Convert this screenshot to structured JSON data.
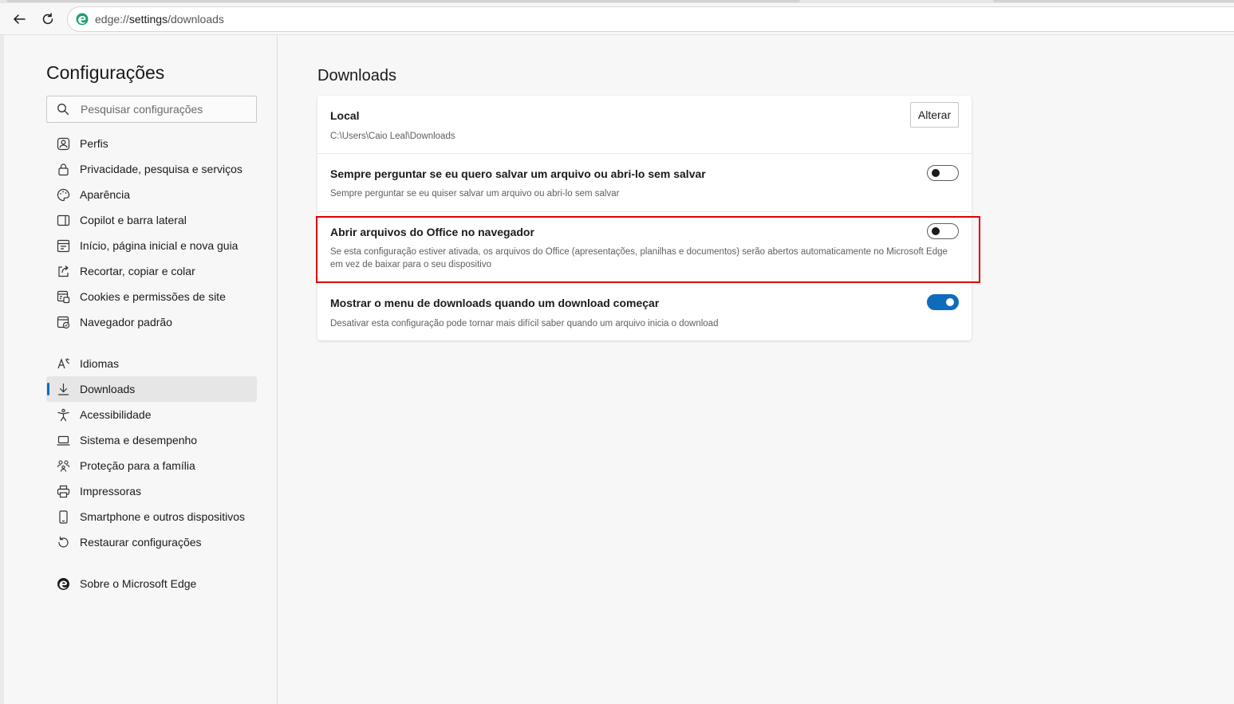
{
  "browser": {
    "url_scheme": "edge://",
    "url_host": "settings",
    "url_path": "/downloads"
  },
  "sidebar": {
    "title": "Configurações",
    "search_placeholder": "Pesquisar configurações",
    "groups": [
      [
        {
          "label": "Perfis",
          "icon": "profile-icon"
        },
        {
          "label": "Privacidade, pesquisa e serviços",
          "icon": "lock-icon"
        },
        {
          "label": "Aparência",
          "icon": "palette-icon"
        },
        {
          "label": "Copilot e barra lateral",
          "icon": "sidebar-icon"
        },
        {
          "label": "Início, página inicial e nova guia",
          "icon": "home-grid-icon"
        },
        {
          "label": "Recortar, copiar e colar",
          "icon": "share-icon"
        },
        {
          "label": "Cookies e permissões de site",
          "icon": "cookie-icon"
        },
        {
          "label": "Navegador padrão",
          "icon": "browser-icon"
        }
      ],
      [
        {
          "label": "Idiomas",
          "icon": "language-icon"
        },
        {
          "label": "Downloads",
          "icon": "download-icon",
          "active": true
        },
        {
          "label": "Acessibilidade",
          "icon": "accessibility-icon"
        },
        {
          "label": "Sistema e desempenho",
          "icon": "laptop-icon"
        },
        {
          "label": "Proteção para a família",
          "icon": "family-icon"
        },
        {
          "label": "Impressoras",
          "icon": "printer-icon"
        },
        {
          "label": "Smartphone e outros dispositivos",
          "icon": "phone-icon"
        },
        {
          "label": "Restaurar configurações",
          "icon": "reset-icon"
        }
      ],
      [
        {
          "label": "Sobre o Microsoft Edge",
          "icon": "edge-logo-icon"
        }
      ]
    ]
  },
  "main": {
    "title": "Downloads",
    "settings": {
      "location": {
        "title": "Local",
        "path": "C:\\Users\\Caio Leal\\Downloads",
        "button": "Alterar"
      },
      "always_ask": {
        "title": "Sempre perguntar se eu quero salvar um arquivo ou abri-lo sem salvar",
        "description": "Sempre perguntar se eu quiser salvar um arquivo ou abri-lo sem salvar",
        "enabled": false
      },
      "office_in_browser": {
        "title": "Abrir arquivos do Office no navegador",
        "description": "Se esta configuração estiver ativada, os arquivos do Office (apresentações, planilhas e documentos) serão abertos automaticamente no Microsoft Edge em vez de baixar para o seu dispositivo",
        "enabled": false
      },
      "show_menu": {
        "title": "Mostrar o menu de downloads quando um download começar",
        "description": "Desativar esta configuração pode tornar mais difícil saber quando um arquivo inicia o download",
        "enabled": true
      }
    }
  },
  "colors": {
    "accent": "#0f6cbd",
    "highlight": "#e00000"
  }
}
